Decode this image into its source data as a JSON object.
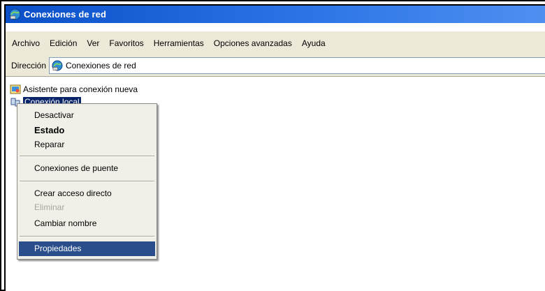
{
  "window": {
    "title": "Conexiones de red",
    "icon": "network-connections-icon",
    "title_bar_color": "#0a4fc7"
  },
  "menubar": {
    "items": [
      "Archivo",
      "Edición",
      "Ver",
      "Favoritos",
      "Herramientas",
      "Opciones avanzadas",
      "Ayuda"
    ]
  },
  "addressbar": {
    "label": "Dirección",
    "value": "Conexiones de red",
    "icon": "network-connections-icon"
  },
  "items": [
    {
      "label": "Asistente para conexión nueva",
      "icon": "new-connection-wizard-icon"
    },
    {
      "label": "Conexión local",
      "icon": "local-connection-icon",
      "selected": true
    }
  ],
  "context_menu": {
    "items": [
      {
        "label": "Desactivar"
      },
      {
        "label": "Estado",
        "default": true
      },
      {
        "label": "Reparar"
      },
      {
        "label": "Conexiones de puente"
      },
      {
        "label": "Crear acceso directo"
      },
      {
        "label": "Eliminar",
        "disabled": true
      },
      {
        "label": "Cambiar nombre"
      },
      {
        "label": "Propiedades",
        "highlighted": true
      }
    ],
    "highlight_color": "#2a4e8c"
  }
}
